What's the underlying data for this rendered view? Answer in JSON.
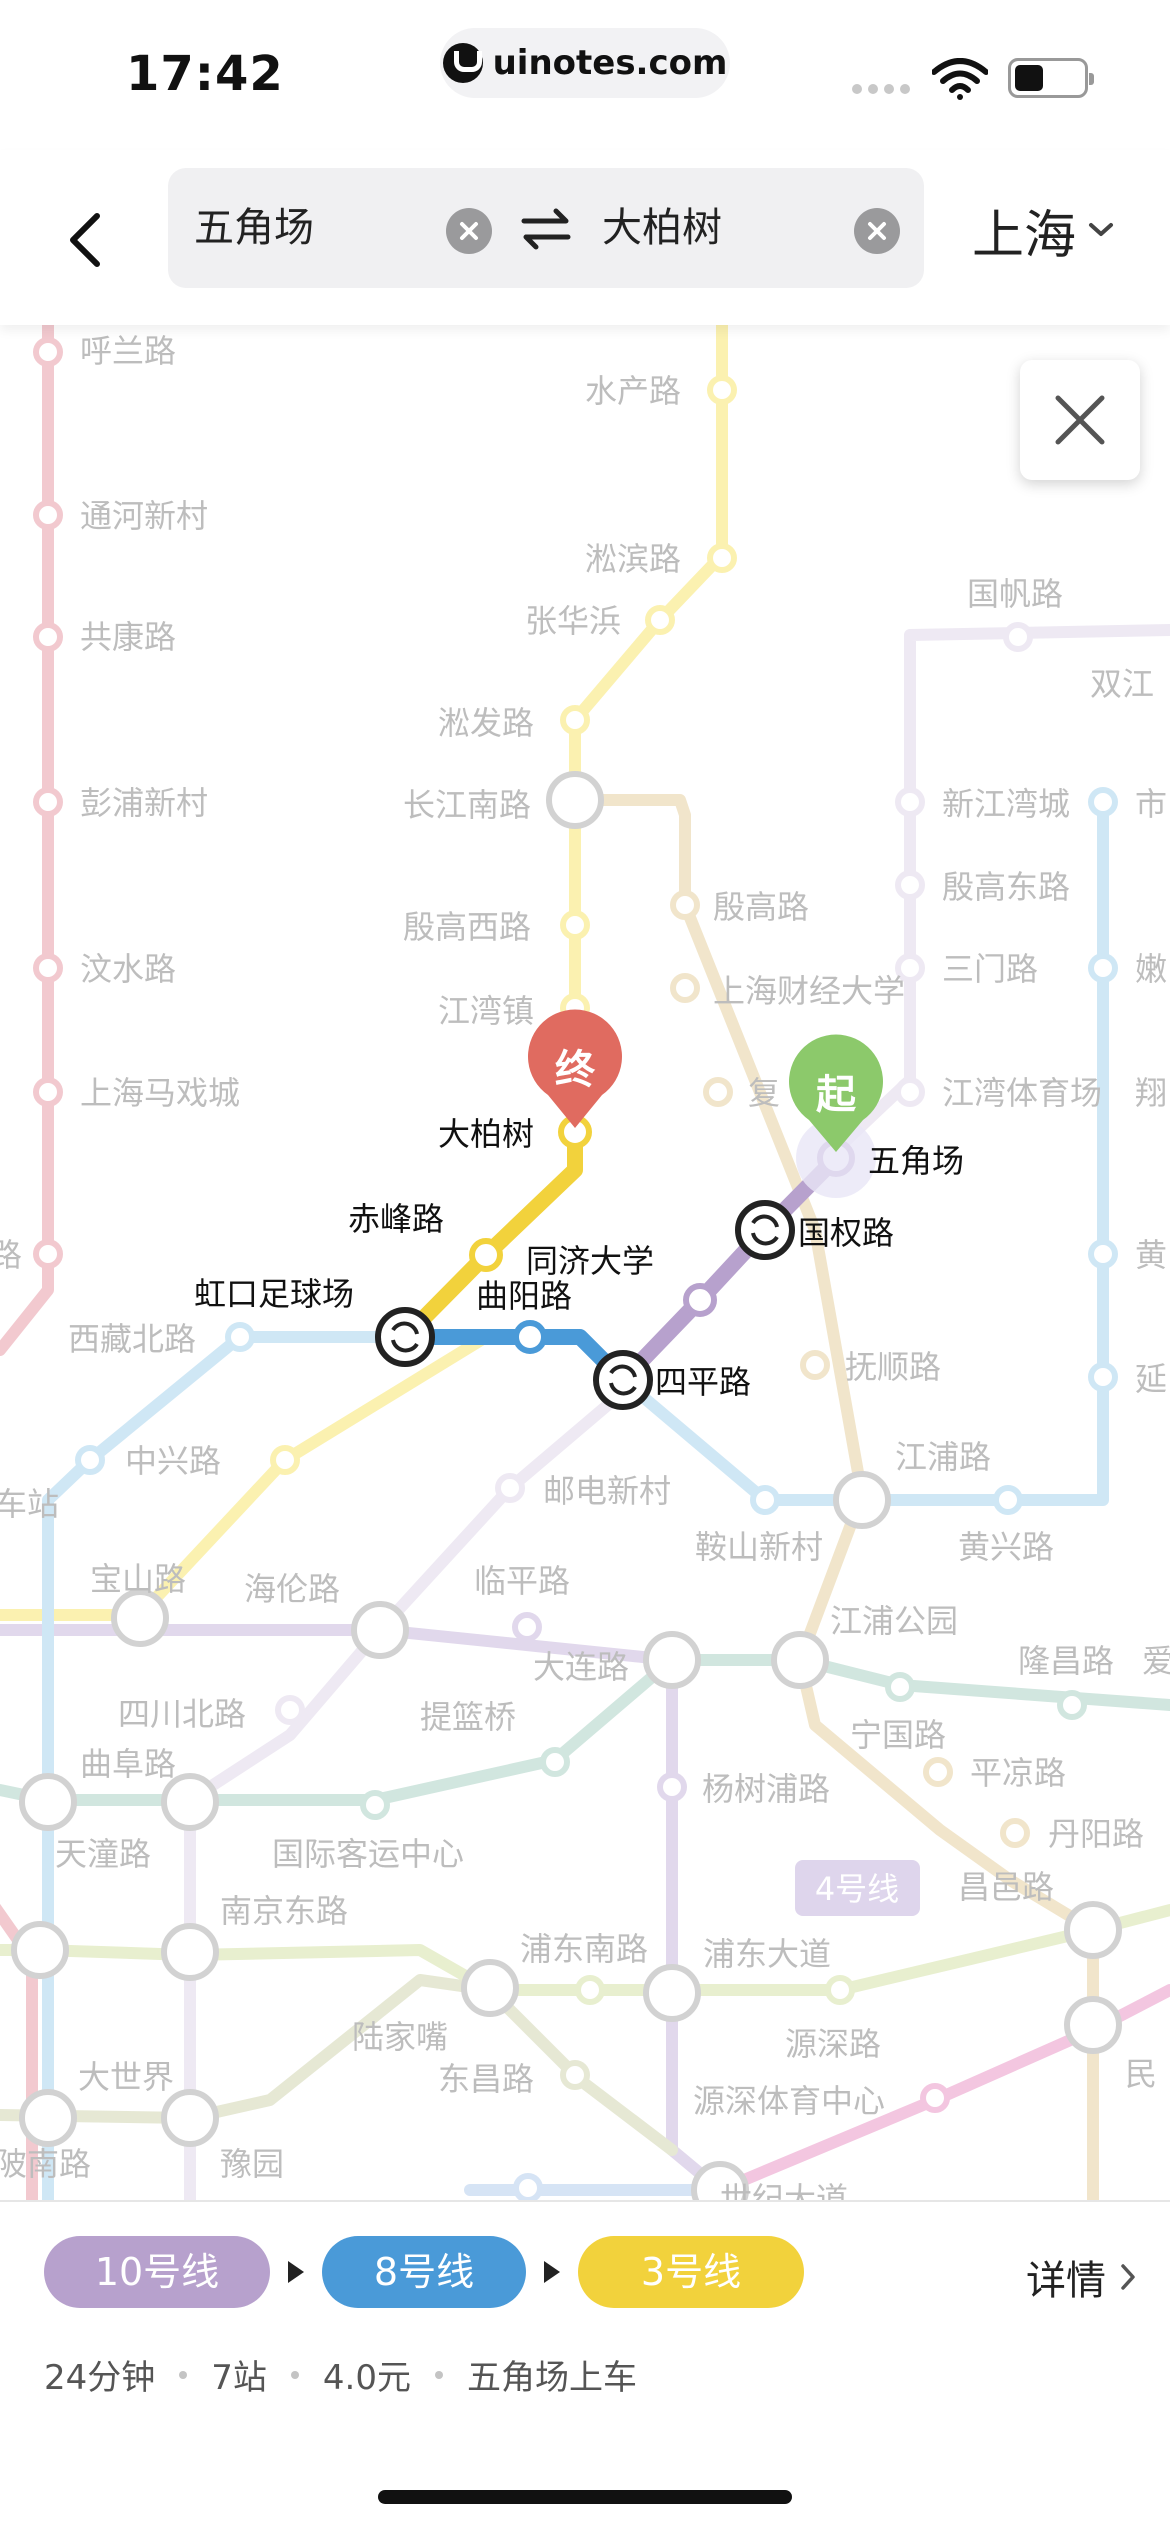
{
  "status_bar": {
    "time": "17:42",
    "url": "uinotes.com"
  },
  "search": {
    "from": "五角场",
    "to": "大柏树",
    "city": "上海"
  },
  "map": {
    "start_marker": "起",
    "end_marker": "终",
    "line_tag": "4号线",
    "colors": {
      "line3": "#f2d23c",
      "line8": "#4a9ad8",
      "line10": "#b7a1cd",
      "start": "#8cc96b",
      "end": "#e06b60"
    },
    "stations": {
      "hulan": "呼兰路",
      "tonghe": "通河新村",
      "gongkang": "共康路",
      "pengpu": "彭浦新村",
      "wenshui": "汶水路",
      "shmaxicheng": "上海马戏城",
      "xizangbei": "西藏北路",
      "zhongxing": "中兴路",
      "chezhan": "车站",
      "baoshan": "宝山路",
      "hailun": "海伦路",
      "sichuanbei": "四川北路",
      "qufu": "曲阜路",
      "tiantong": "天潼路",
      "intl_cruise": "国际客运中心",
      "nanjingdong": "南京东路",
      "lujiazui": "陆家嘴",
      "dongchang": "东昌路",
      "dashijie": "大世界",
      "yuyuan": "豫园",
      "ponan": "陂南路",
      "shuichan": "水产路",
      "songbin": "淞滨路",
      "zhanghuabang": "张华浜",
      "songfa": "淞发路",
      "changjiangnan": "长江南路",
      "yingaoxi": "殷高西路",
      "jiangwanzhen": "江湾镇",
      "dabaishu": "大柏树",
      "chifeng": "赤峰路",
      "hongkou": "虹口足球场",
      "tongji": "同济大学",
      "quyang": "曲阳路",
      "siping": "四平路",
      "guoquan": "国权路",
      "wujiaochang": "五角场",
      "yingao": "殷高路",
      "caijing": "上海财经大学",
      "fudan": "复旦大学",
      "fushun": "抚顺路",
      "jiangpu": "江浦路",
      "huangxing": "黄兴路",
      "anshan": "鞍山新村",
      "youdian": "邮电新村",
      "linping": "临平路",
      "dalian": "大连路",
      "tilanqiao": "提篮桥",
      "jiangpu_park": "江浦公园",
      "ningguo": "宁国路",
      "longchang": "隆昌路",
      "aiguo": "爱",
      "yangshupu": "杨树浦路",
      "pingliang": "平凉路",
      "danyang": "丹阳路",
      "changyi": "昌邑路",
      "pudongnan": "浦东南路",
      "pudongdadao": "浦东大道",
      "yuanshen": "源深路",
      "yuanshen_sports": "源深体育中心",
      "century": "世纪大道",
      "min": "民",
      "guofan": "国帆路",
      "shuangjiang": "双江",
      "xinjiangwan": "新江湾城",
      "yingaodong": "殷高东路",
      "sanmen": "三门路",
      "jiangwan_sports": "江湾体育场",
      "shi": "市",
      "nen": "嫩",
      "xiang": "翔",
      "huang": "黄",
      "yan": "延",
      "lu_edge": "路",
      "fu_edge": "复"
    }
  },
  "bottom": {
    "lines": [
      {
        "label": "10号线",
        "color": "#b7a1cd"
      },
      {
        "label": "8号线",
        "color": "#4a9ad8"
      },
      {
        "label": "3号线",
        "color": "#f2d23c"
      }
    ],
    "details": "详情",
    "duration": "24分钟",
    "stops": "7站",
    "fare": "4.0元",
    "board": "五角场上车"
  }
}
